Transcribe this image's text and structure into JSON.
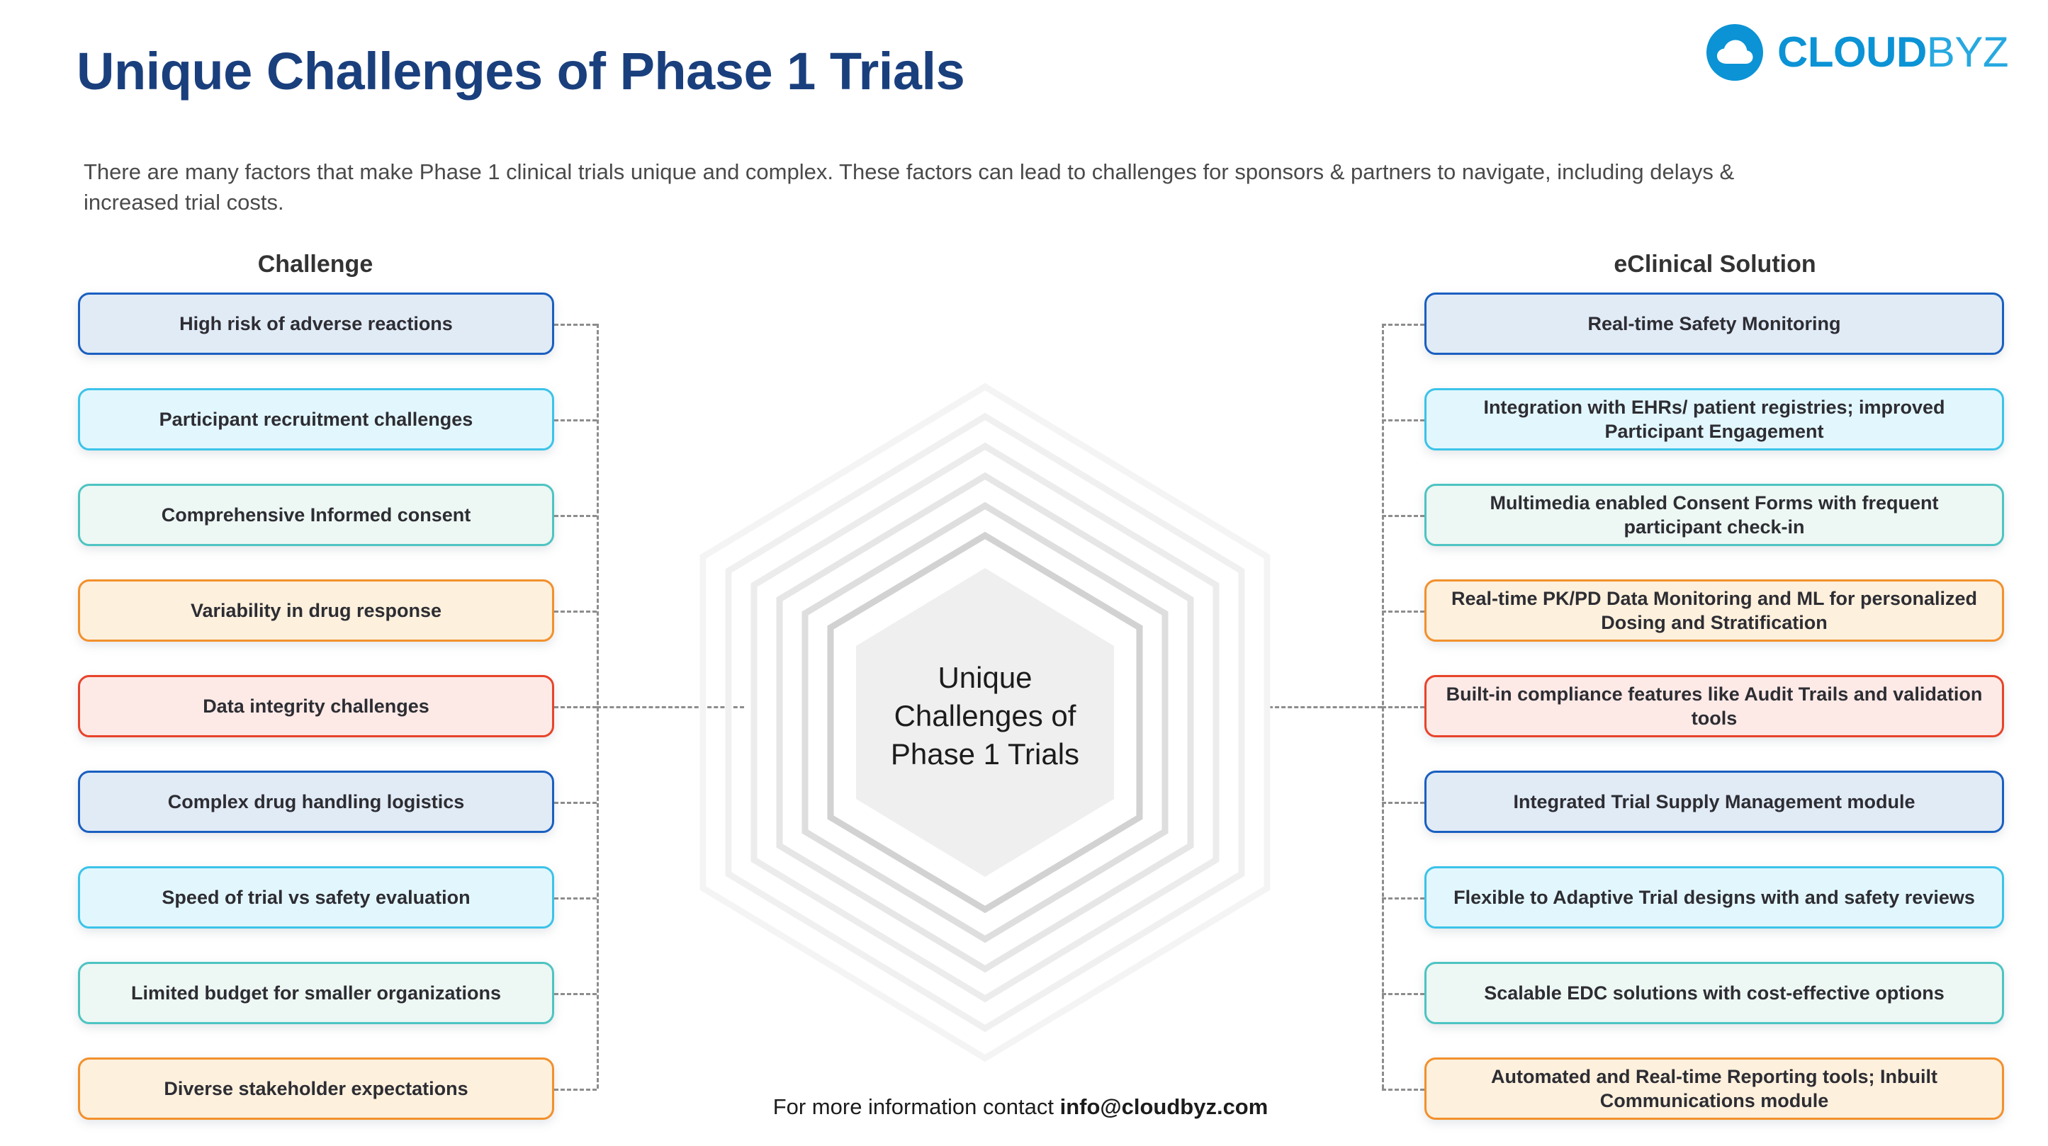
{
  "header": {
    "title": "Unique Challenges of Phase 1 Trials",
    "subtitle": "There are many factors that make Phase 1 clinical trials unique and complex. These factors can lead to challenges for sponsors & partners to navigate, including delays & increased trial costs."
  },
  "logo": {
    "icon": "cloud-icon",
    "text_bold": "CLOUD",
    "text_light": "BYZ",
    "brand_color": "#0b93d5",
    "accent_color": "#27a8e0"
  },
  "columns": {
    "left_header": "Challenge",
    "right_header": "eClinical Solution"
  },
  "center": {
    "label_line1": "Unique",
    "label_line2": "Challenges of",
    "label_line3": "Phase 1 Trials"
  },
  "footer": {
    "prefix": "For more information contact ",
    "email": "info@cloudbyz.com"
  },
  "colors": {
    "title": "#1a3f7d",
    "blue_fill": "#e1ebf6",
    "blue_border": "#1a5fc0",
    "cyan_fill": "#e2f7fd",
    "cyan_border": "#3bc3e9",
    "teal_fill": "#edf7f3",
    "teal_border": "#4ec4c2",
    "orange_fill": "#fdf0dd",
    "orange_border": "#f2902c",
    "red_fill": "#fdeae7",
    "red_border": "#e8432b",
    "connector": "#8d8d8d"
  },
  "challenges": [
    {
      "label": "High risk of adverse reactions",
      "color": "blue"
    },
    {
      "label": "Participant recruitment challenges",
      "color": "cyan"
    },
    {
      "label": "Comprehensive Informed consent",
      "color": "teal"
    },
    {
      "label": "Variability in drug response",
      "color": "orange"
    },
    {
      "label": "Data integrity challenges",
      "color": "red"
    },
    {
      "label": "Complex drug handling logistics",
      "color": "blue"
    },
    {
      "label": "Speed of trial vs safety evaluation",
      "color": "cyan"
    },
    {
      "label": "Limited budget for smaller organizations",
      "color": "teal"
    },
    {
      "label": "Diverse stakeholder expectations",
      "color": "orange"
    }
  ],
  "solutions": [
    {
      "label": "Real-time Safety Monitoring",
      "color": "blue"
    },
    {
      "label": "Integration with EHRs/ patient registries; improved Participant Engagement",
      "color": "cyan"
    },
    {
      "label": "Multimedia enabled Consent Forms with frequent participant check-in",
      "color": "teal"
    },
    {
      "label": "Real-time PK/PD Data Monitoring and ML for personalized Dosing and Stratification",
      "color": "orange"
    },
    {
      "label": "Built-in compliance features like Audit Trails and validation tools",
      "color": "red"
    },
    {
      "label": "Integrated Trial Supply Management module",
      "color": "blue"
    },
    {
      "label": "Flexible to Adaptive Trial designs with and safety reviews",
      "color": "cyan"
    },
    {
      "label": "Scalable EDC solutions with cost-effective options",
      "color": "teal"
    },
    {
      "label": "Automated and Real-time Reporting tools; Inbuilt Communications module",
      "color": "orange"
    }
  ]
}
